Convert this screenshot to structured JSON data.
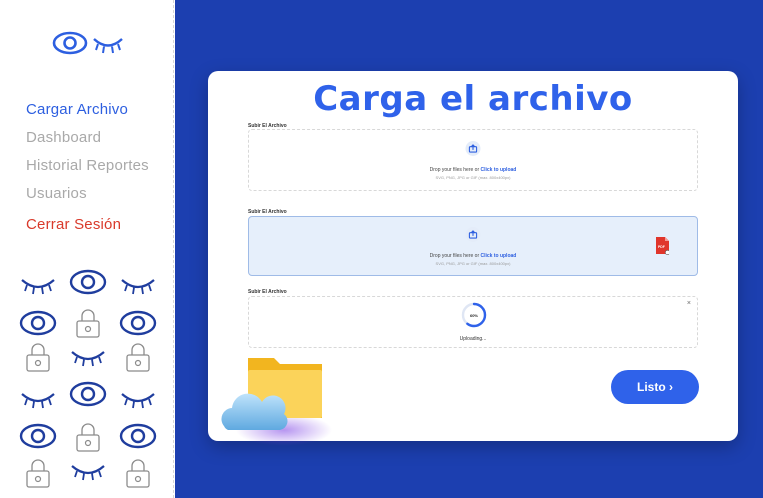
{
  "sidebar": {
    "logo_icon": "eye-open-and-closed-logo",
    "items": [
      {
        "label": "Cargar Archivo",
        "state": "active"
      },
      {
        "label": "Dashboard",
        "state": "inactive"
      },
      {
        "label": "Historial Reportes",
        "state": "inactive"
      },
      {
        "label": "Usuarios",
        "state": "inactive"
      },
      {
        "label": "Cerrar Sesión",
        "state": "logout"
      }
    ],
    "pattern_icons": [
      "closed-eye-icon",
      "eye-icon",
      "lock-icon"
    ]
  },
  "card": {
    "title": "Carga el archivo",
    "uploads": [
      {
        "label": "Subir El Archivo",
        "state": "idle",
        "text_prefix": "Drop your files here or ",
        "link": "Click to upload",
        "hint": "SVG, PNG, JPG or GIF (max. 800x400px)"
      },
      {
        "label": "Subir El Archivo",
        "state": "drag-over",
        "text_prefix": "Drop your files here or ",
        "link": "Click to upload",
        "hint": "SVG, PNG, JPG or GIF (max. 800x400px)",
        "file_icon": "pdf-file-icon",
        "file_badge": "PDF"
      },
      {
        "label": "Subir El Archivo",
        "state": "uploading",
        "progress_percent": 60,
        "progress_text": "60%",
        "status": "Uploading...",
        "close_label": "×"
      }
    ],
    "done_button": "Listo ›"
  },
  "colors": {
    "accent": "#2f62ea",
    "main_bg": "#1c3fb0",
    "logout": "#d93a2b",
    "inactive": "#a9a9a9"
  }
}
